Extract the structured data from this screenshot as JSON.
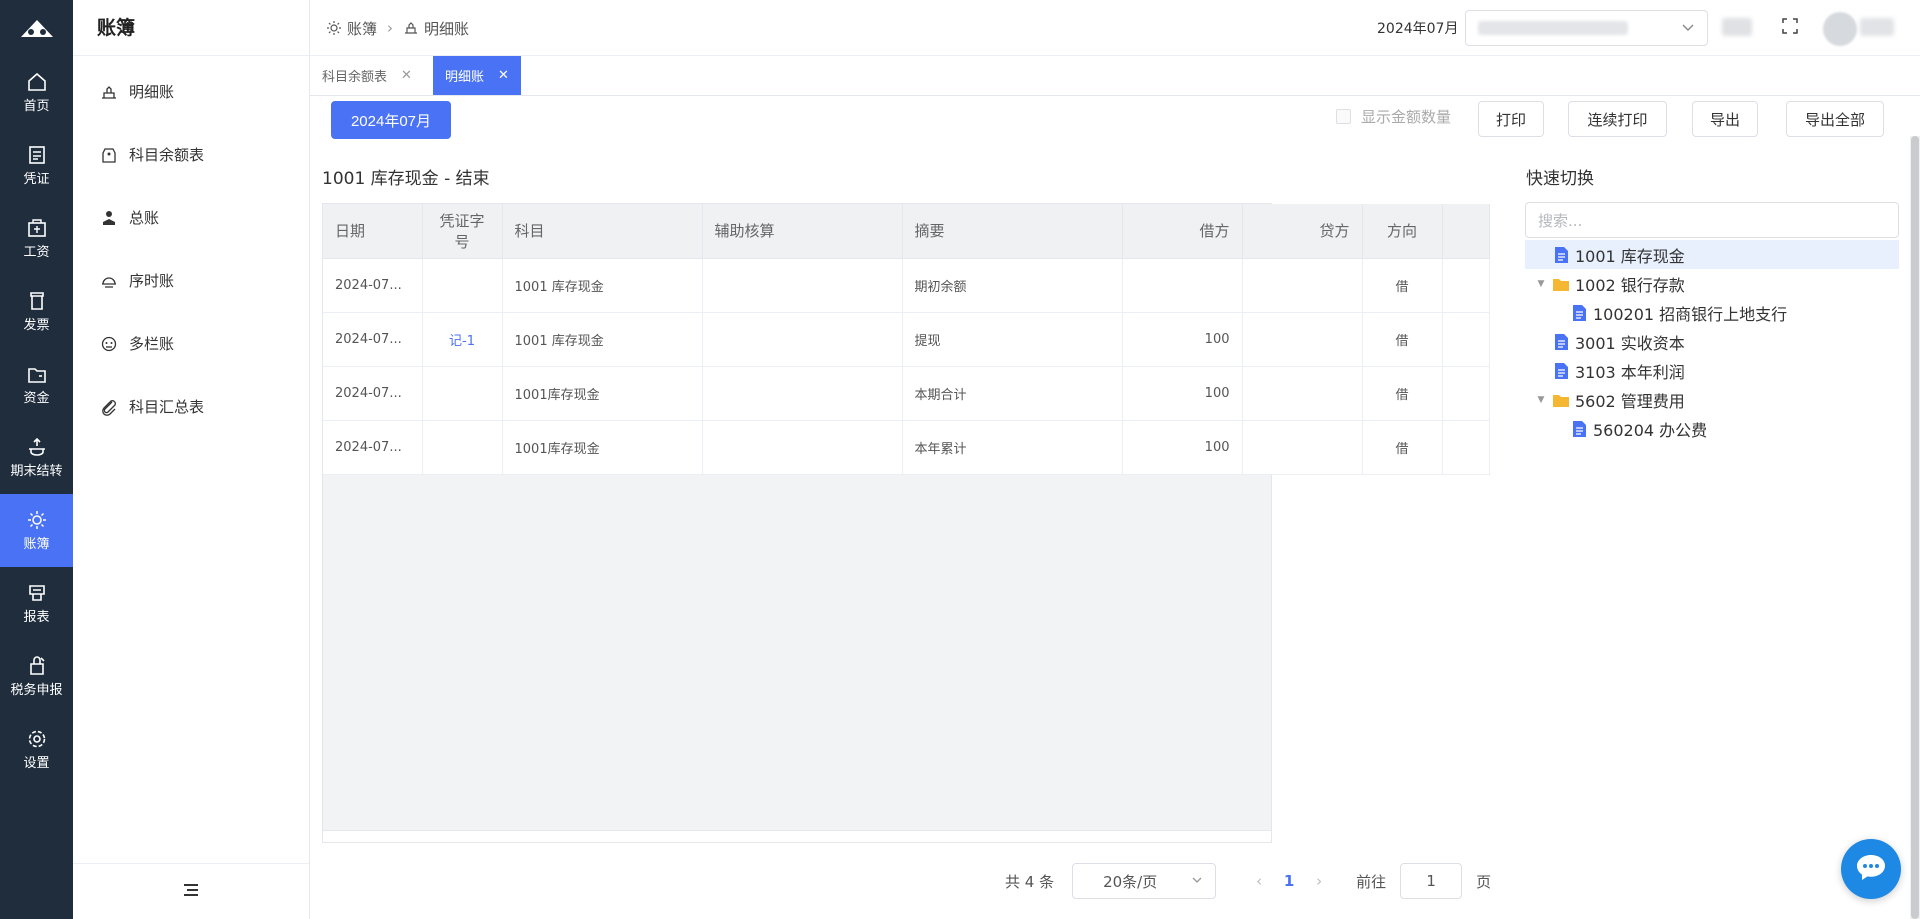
{
  "nav": {
    "items": [
      {
        "label": "首页",
        "icon": "home-icon"
      },
      {
        "label": "凭证",
        "icon": "voucher-icon"
      },
      {
        "label": "工资",
        "icon": "salary-icon"
      },
      {
        "label": "发票",
        "icon": "invoice-icon"
      },
      {
        "label": "资金",
        "icon": "funds-icon"
      },
      {
        "label": "期末结转",
        "icon": "period-close-icon"
      },
      {
        "label": "账簿",
        "icon": "ledger-icon",
        "active": true
      },
      {
        "label": "报表",
        "icon": "report-icon"
      },
      {
        "label": "税务申报",
        "icon": "tax-icon"
      },
      {
        "label": "设置",
        "icon": "settings-icon"
      }
    ]
  },
  "submenu": {
    "title": "账簿",
    "items": [
      {
        "label": "明细账",
        "icon": "detail-ledger-icon"
      },
      {
        "label": "科目余额表",
        "icon": "balance-icon"
      },
      {
        "label": "总账",
        "icon": "general-ledger-icon"
      },
      {
        "label": "序时账",
        "icon": "journal-icon"
      },
      {
        "label": "多栏账",
        "icon": "multi-column-icon"
      },
      {
        "label": "科目汇总表",
        "icon": "summary-icon"
      }
    ]
  },
  "header": {
    "breadcrumb": [
      "账簿",
      "明细账"
    ],
    "period": "2024年07月"
  },
  "tabs": [
    {
      "label": "科目余额表",
      "active": false
    },
    {
      "label": "明细账",
      "active": true
    }
  ],
  "toolbar": {
    "date_button": "2024年07月",
    "show_qty_label": "显示金额数量",
    "print": "打印",
    "continuous_print": "连续打印",
    "export": "导出",
    "export_all": "导出全部"
  },
  "table": {
    "title": "1001 库存现金 - 结束",
    "headers": [
      "日期",
      "凭证字号",
      "科目",
      "辅助核算",
      "摘要",
      "借方",
      "贷方",
      "方向"
    ],
    "rows": [
      {
        "date": "2024-07...",
        "voucher": "",
        "account": "1001 库存现金",
        "aux": "",
        "summary": "期初余额",
        "debit": "",
        "credit": "",
        "dir": "借"
      },
      {
        "date": "2024-07...",
        "voucher": "记-1",
        "account": "1001 库存现金",
        "aux": "",
        "summary": "提现",
        "debit": "100",
        "credit": "",
        "dir": "借"
      },
      {
        "date": "2024-07...",
        "voucher": "",
        "account": "1001库存现金",
        "aux": "",
        "summary": "本期合计",
        "debit": "100",
        "credit": "",
        "dir": "借"
      },
      {
        "date": "2024-07...",
        "voucher": "",
        "account": "1001库存现金",
        "aux": "",
        "summary": "本年累计",
        "debit": "100",
        "credit": "",
        "dir": "借"
      }
    ]
  },
  "pagination": {
    "total": "共 4 条",
    "page_size": "20条/页",
    "current": "1",
    "goto_label": "前往",
    "goto_value": "1",
    "page_suffix": "页"
  },
  "quick_switch": {
    "title": "快速切换",
    "search_placeholder": "搜索...",
    "tree": [
      {
        "label": "1001 库存现金",
        "type": "file",
        "level": 0,
        "selected": true
      },
      {
        "label": "1002 银行存款",
        "type": "folder",
        "level": 0,
        "expanded": true
      },
      {
        "label": "100201 招商银行上地支行",
        "type": "file",
        "level": 1
      },
      {
        "label": "3001 实收资本",
        "type": "file",
        "level": 0
      },
      {
        "label": "3103 本年利润",
        "type": "file",
        "level": 0
      },
      {
        "label": "5602 管理费用",
        "type": "folder",
        "level": 0,
        "expanded": true
      },
      {
        "label": "560204 办公费",
        "type": "file",
        "level": 1
      }
    ]
  },
  "colors": {
    "accent": "#4a72f5",
    "nav_bg": "#1f2d3d",
    "folder": "#f5b731",
    "file": "#4a72f5"
  }
}
